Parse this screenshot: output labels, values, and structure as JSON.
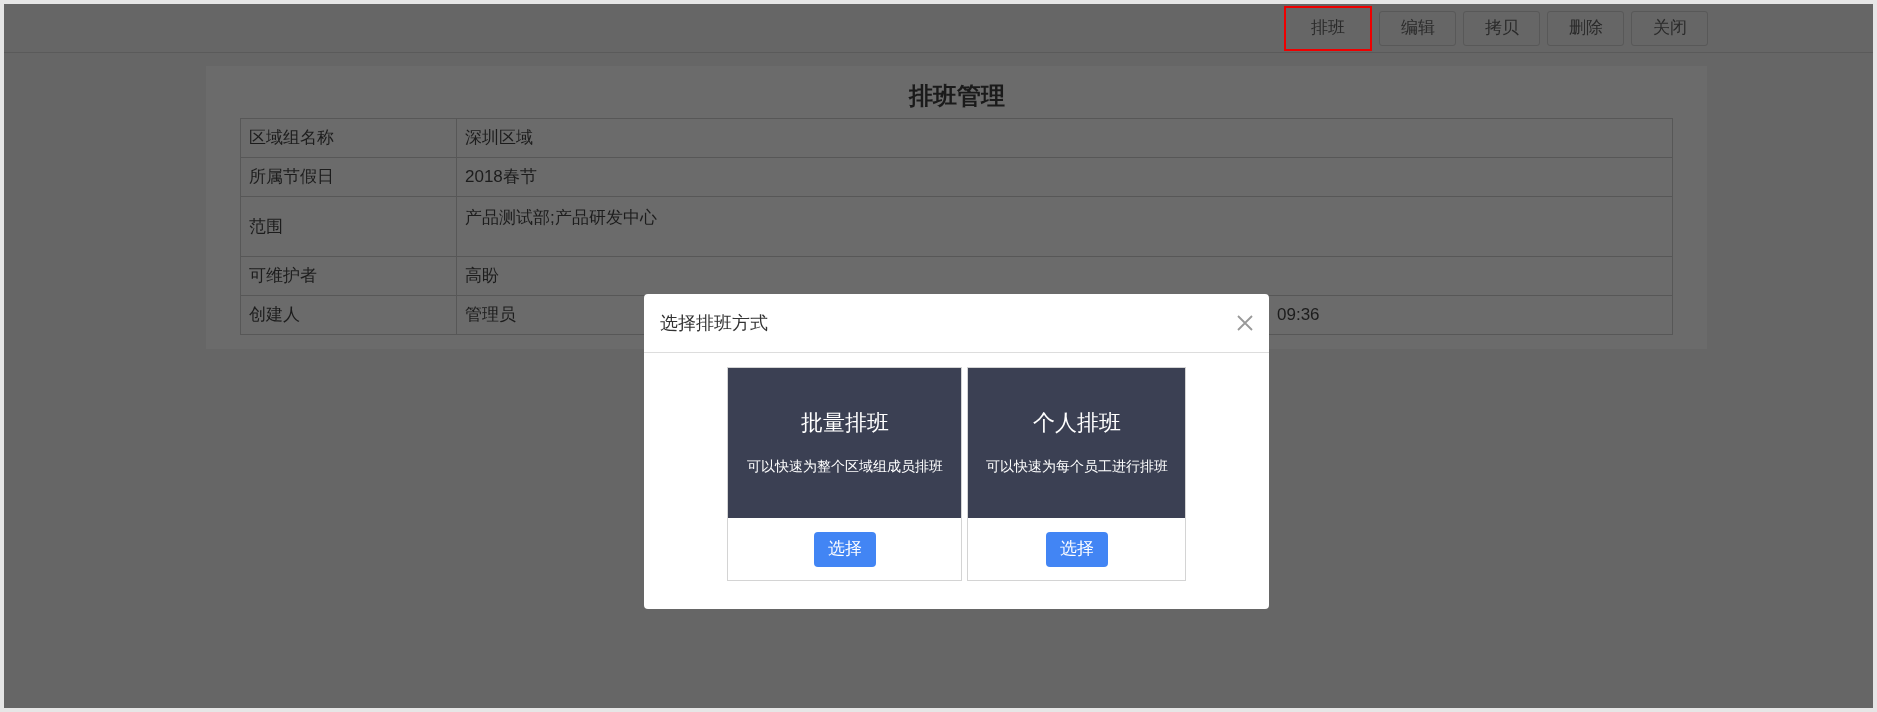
{
  "toolbar": {
    "buttons": [
      {
        "label": "排班",
        "highlighted": true
      },
      {
        "label": "编辑",
        "highlighted": false
      },
      {
        "label": "拷贝",
        "highlighted": false
      },
      {
        "label": "删除",
        "highlighted": false
      },
      {
        "label": "关闭",
        "highlighted": false
      }
    ]
  },
  "panel": {
    "title": "排班管理",
    "rows": [
      {
        "kind": "single",
        "label": "区域组名称",
        "value": "深圳区域"
      },
      {
        "kind": "single",
        "label": "所属节假日",
        "value": "2018春节"
      },
      {
        "kind": "multiline",
        "label": "范围",
        "value": "产品测试部;产品研发中心"
      },
      {
        "kind": "single",
        "label": "可维护者",
        "value": "高盼"
      },
      {
        "kind": "split",
        "label": "创建人",
        "value": "管理员",
        "column_4": "09:36"
      }
    ]
  },
  "dialog": {
    "title": "选择排班方式",
    "options": [
      {
        "title": "批量排班",
        "description": "可以快速为整个区域组成员排班",
        "button": "选择"
      },
      {
        "title": "个人排班",
        "description": "可以快速为每个员工进行排班",
        "button": "选择"
      }
    ]
  }
}
